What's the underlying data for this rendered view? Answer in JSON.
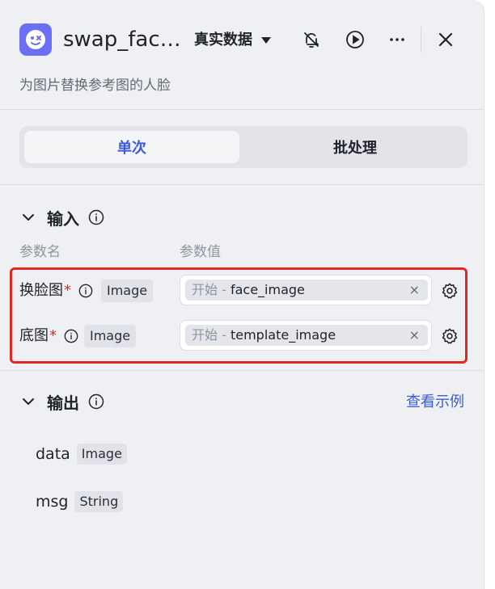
{
  "header": {
    "title": "swap_fac…",
    "data_mode": "真实数据",
    "description": "为图片替换参考图的人脸",
    "icons": [
      "app-logo-icon",
      "dropdown-caret-icon",
      "bell-off-icon",
      "play-circle-icon",
      "more-icon",
      "close-icon"
    ]
  },
  "tabs": [
    {
      "label": "单次",
      "active": true
    },
    {
      "label": "批处理",
      "active": false
    }
  ],
  "input_section": {
    "title": "输入",
    "col_name": "参数名",
    "col_value": "参数值",
    "params": [
      {
        "name": "换脸图",
        "required": "*",
        "type": "Image",
        "prefix": "开始 -",
        "value": "face_image",
        "clear": "×"
      },
      {
        "name": "底图",
        "required": "*",
        "type": "Image",
        "prefix": "开始 -",
        "value": "template_image",
        "clear": "×"
      }
    ]
  },
  "output_section": {
    "title": "输出",
    "example_link": "查看示例",
    "outputs": [
      {
        "name": "data",
        "type": "Image"
      },
      {
        "name": "msg",
        "type": "String"
      }
    ]
  },
  "colors": {
    "accent": "#3b5bdb",
    "logo": "#6b6ff5",
    "highlight": "#e3291f",
    "panel_bg": "#eef0f4"
  }
}
